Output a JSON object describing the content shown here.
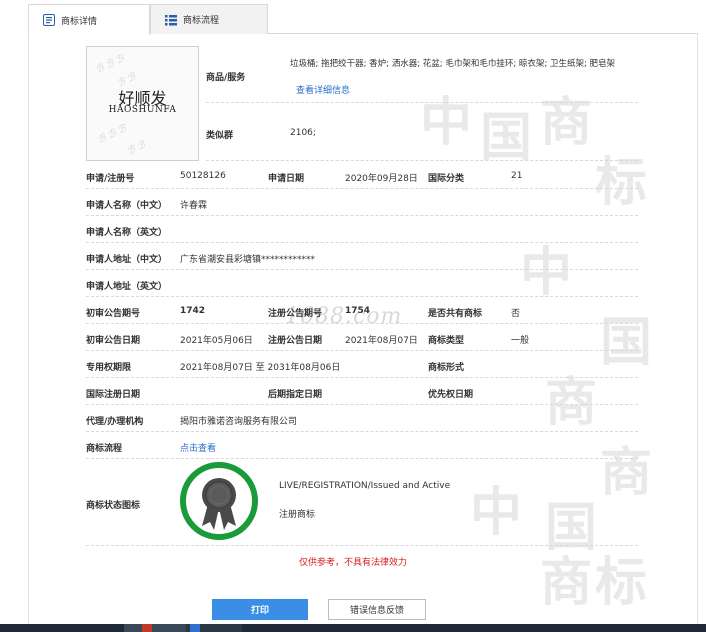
{
  "tabs": [
    {
      "label": "商标详情",
      "active": true
    },
    {
      "label": "商标流程",
      "active": false
    }
  ],
  "logo": {
    "cn": "好顺发",
    "en": "HAOSHUNFA"
  },
  "goods": {
    "label": "商品/服务",
    "value": "垃圾桶; 拖把绞干器; 香炉; 洒水器; 花盆; 毛巾架和毛巾挂环; 晾衣架; 卫生纸架; 肥皂架",
    "detail_link": "查看详细信息"
  },
  "similar_group": {
    "label": "类似群",
    "value": "2106;"
  },
  "fields": {
    "reg_no_label": "申请/注册号",
    "reg_no": "50128126",
    "apply_date_label": "申请日期",
    "apply_date": "2020年09月28日",
    "intl_class_label": "国际分类",
    "intl_class": "21",
    "applicant_cn_label": "申请人名称（中文）",
    "applicant_cn": "许春霖",
    "applicant_en_label": "申请人名称（英文）",
    "address_cn_label": "申请人地址（中文）",
    "address_cn": "广东省潮安县彩塘镇************",
    "address_en_label": "申请人地址（英文）",
    "prelim_no_label": "初审公告期号",
    "prelim_no": "1742",
    "reg_pub_no_label": "注册公告期号",
    "reg_pub_no": "1754",
    "shared_label": "是否共有商标",
    "shared": "否",
    "prelim_date_label": "初审公告日期",
    "prelim_date": "2021年05月06日",
    "reg_pub_date_label": "注册公告日期",
    "reg_pub_date": "2021年08月07日",
    "tm_type_label": "商标类型",
    "tm_type": "一般",
    "exclusive_label": "专用权期限",
    "exclusive": "2021年08月07日 至 2031年08月06日",
    "tm_form_label": "商标形式",
    "intl_reg_date_label": "国际注册日期",
    "later_date_label": "后期指定日期",
    "priority_label": "优先权日期",
    "agent_label": "代理/办理机构",
    "agent": "揭阳市雅诺咨询服务有限公司",
    "process_label": "商标流程",
    "process_link": "点击查看",
    "status_icon_label": "商标状态图标",
    "status_en": "LIVE/REGISTRATION/Issued and Active",
    "status_cn": "注册商标"
  },
  "watermark_site": "1688.com",
  "disclaimer": "仅供参考，不具有法律效力",
  "buttons": {
    "print": "打印",
    "feedback": "错误信息反馈"
  },
  "colors": {
    "accent": "#3a8ee6",
    "link": "#2a6fc9",
    "seal": "#1a9a3a",
    "warning": "#d9201c"
  }
}
